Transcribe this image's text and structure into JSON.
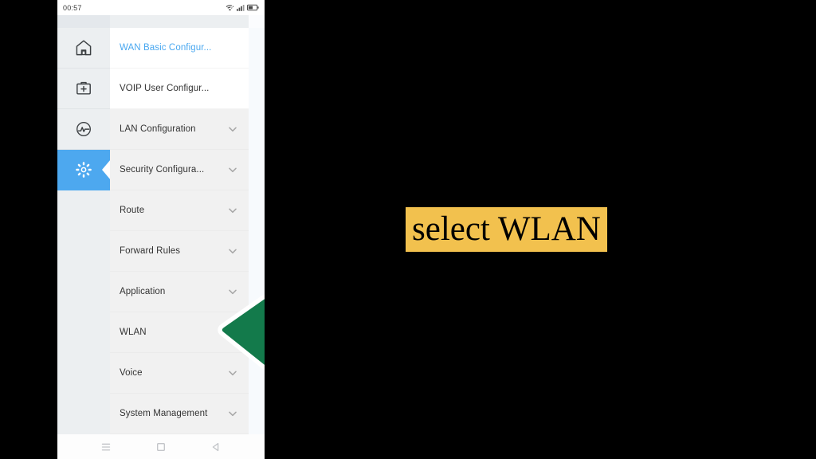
{
  "statusbar": {
    "time": "00:57",
    "icons": [
      "wifi-icon",
      "signal-icon",
      "battery-icon"
    ]
  },
  "rail": {
    "items": [
      {
        "name": "home-icon",
        "label": "Home",
        "active": false
      },
      {
        "name": "toolkit-icon",
        "label": "Maintenance",
        "active": false
      },
      {
        "name": "diagnostics-icon",
        "label": "Diagnostics",
        "active": false
      },
      {
        "name": "gear-icon",
        "label": "Settings",
        "active": true
      }
    ],
    "active_color": "#4da8ef"
  },
  "menu": {
    "items": [
      {
        "label": "WAN Basic Configur...",
        "expandable": false,
        "active": true,
        "white_bg": true
      },
      {
        "label": "VOIP User Configur...",
        "expandable": false,
        "active": false,
        "white_bg": true
      },
      {
        "label": "LAN Configuration",
        "expandable": true,
        "active": false,
        "white_bg": false
      },
      {
        "label": "Security Configura...",
        "expandable": true,
        "active": false,
        "white_bg": false
      },
      {
        "label": "Route",
        "expandable": true,
        "active": false,
        "white_bg": false
      },
      {
        "label": "Forward Rules",
        "expandable": true,
        "active": false,
        "white_bg": false
      },
      {
        "label": "Application",
        "expandable": true,
        "active": false,
        "white_bg": false
      },
      {
        "label": "WLAN",
        "expandable": true,
        "active": false,
        "white_bg": false
      },
      {
        "label": "Voice",
        "expandable": true,
        "active": false,
        "white_bg": false
      },
      {
        "label": "System Management",
        "expandable": true,
        "active": false,
        "white_bg": false
      }
    ],
    "active_text_color": "#4aa8f0"
  },
  "navbar": {
    "items": [
      {
        "name": "recents-icon",
        "label": "Recents"
      },
      {
        "name": "home-square-icon",
        "label": "Home"
      },
      {
        "name": "back-triangle-icon",
        "label": "Back"
      }
    ]
  },
  "annotation": {
    "arrow": {
      "name": "green-arrow-pointing-left",
      "color": "#137A4B",
      "outline": "#ffffff",
      "points_at": "WLAN"
    },
    "caption": {
      "text": "select WLAN",
      "background": "#F2C14E",
      "color": "#000000"
    }
  }
}
